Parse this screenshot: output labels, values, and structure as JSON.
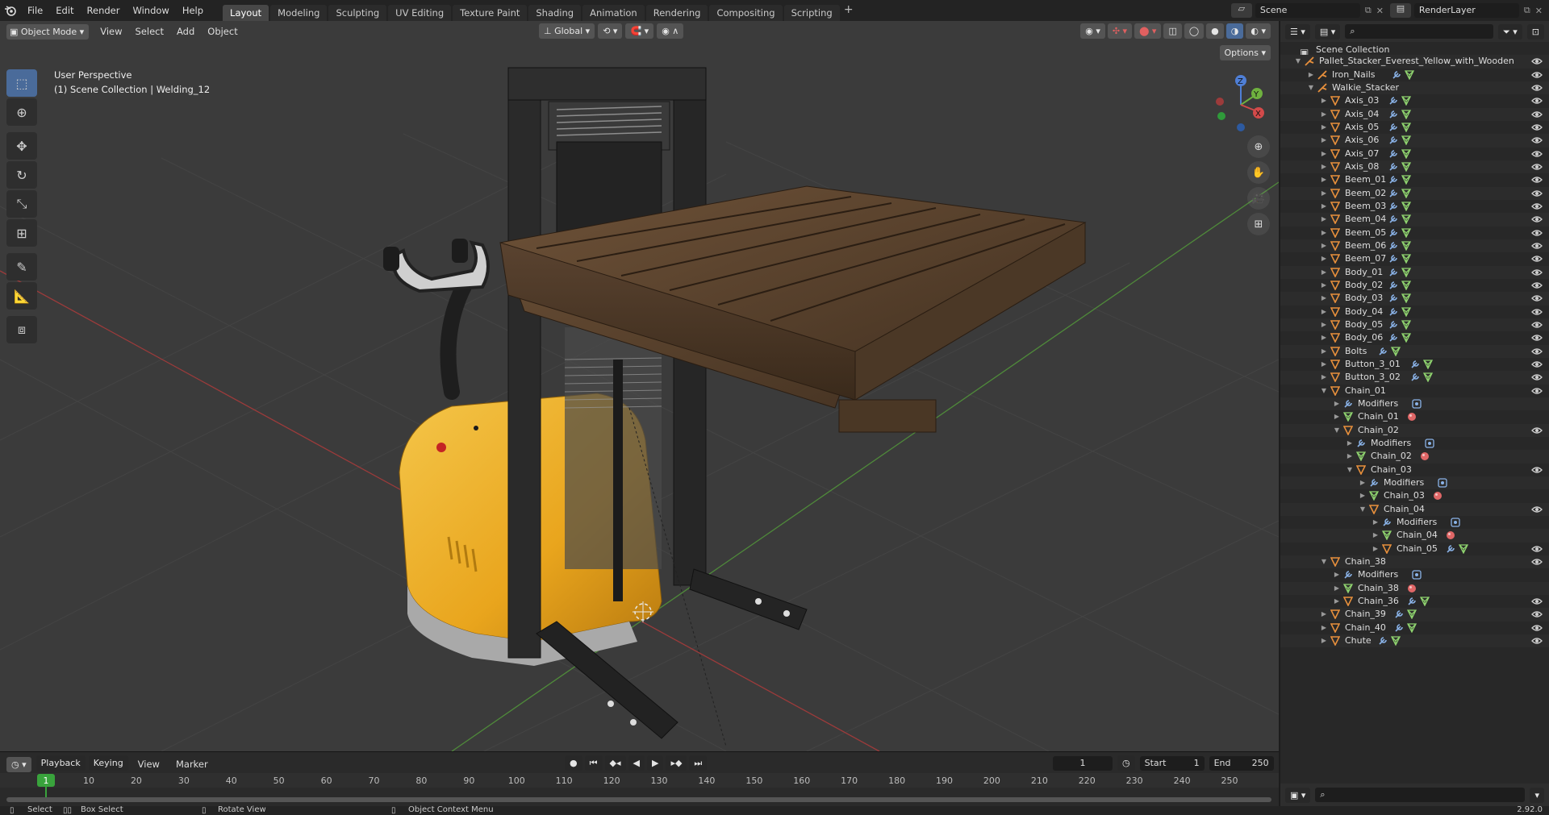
{
  "topbar": {
    "menus": [
      "File",
      "Edit",
      "Render",
      "Window",
      "Help"
    ],
    "workspaces": [
      "Layout",
      "Modeling",
      "Sculpting",
      "UV Editing",
      "Texture Paint",
      "Shading",
      "Animation",
      "Rendering",
      "Compositing",
      "Scripting"
    ],
    "active_workspace": "Layout",
    "scene": "Scene",
    "render_layer": "RenderLayer"
  },
  "viewport": {
    "mode": "Object Mode",
    "menus": [
      "View",
      "Select",
      "Add",
      "Object"
    ],
    "orientation": "Global",
    "options_label": "Options",
    "info_line1": "User Perspective",
    "info_line2": "(1) Scene Collection | Welding_12",
    "gizmo_axes": {
      "x": "X",
      "y": "Y",
      "z": "Z"
    }
  },
  "timeline": {
    "menus": [
      "Playback",
      "Keying",
      "View",
      "Marker"
    ],
    "current_frame": "1",
    "start_label": "Start",
    "start": "1",
    "end_label": "End",
    "end": "250",
    "ruler_labels": [
      "1",
      "10",
      "20",
      "30",
      "40",
      "50",
      "60",
      "70",
      "80",
      "90",
      "100",
      "110",
      "120",
      "130",
      "140",
      "150",
      "160",
      "170",
      "180",
      "190",
      "200",
      "210",
      "220",
      "230",
      "240",
      "250"
    ]
  },
  "status": {
    "select": "Select",
    "box_select": "Box Select",
    "rotate_view": "Rotate View",
    "context_menu": "Object Context Menu",
    "version": "2.92.0"
  },
  "outliner": {
    "root": "Scene Collection",
    "rows": [
      {
        "name": "Pallet_Stacker_Everest_Yellow_with_Wooden",
        "depth": 1,
        "arrow": "down",
        "icon": "armature",
        "extras": [],
        "eye": true
      },
      {
        "name": "Iron_Nails",
        "depth": 2,
        "arrow": "right",
        "icon": "armature",
        "extras": [
          "wrench",
          "mesh"
        ],
        "eye": true
      },
      {
        "name": "Walkie_Stacker",
        "depth": 2,
        "arrow": "down",
        "icon": "armature",
        "extras": [],
        "eye": true
      },
      {
        "name": "Axis_03",
        "depth": 3,
        "arrow": "right",
        "icon": "object",
        "extras": [
          "wrench",
          "mesh"
        ],
        "eye": true
      },
      {
        "name": "Axis_04",
        "depth": 3,
        "arrow": "right",
        "icon": "object",
        "extras": [
          "wrench",
          "mesh"
        ],
        "eye": true
      },
      {
        "name": "Axis_05",
        "depth": 3,
        "arrow": "right",
        "icon": "object",
        "extras": [
          "wrench",
          "mesh"
        ],
        "eye": true
      },
      {
        "name": "Axis_06",
        "depth": 3,
        "arrow": "right",
        "icon": "object",
        "extras": [
          "wrench",
          "mesh"
        ],
        "eye": true
      },
      {
        "name": "Axis_07",
        "depth": 3,
        "arrow": "right",
        "icon": "object",
        "extras": [
          "wrench",
          "mesh"
        ],
        "eye": true
      },
      {
        "name": "Axis_08",
        "depth": 3,
        "arrow": "right",
        "icon": "object",
        "extras": [
          "wrench",
          "mesh"
        ],
        "eye": true
      },
      {
        "name": "Beem_01",
        "depth": 3,
        "arrow": "right",
        "icon": "object",
        "extras": [
          "wrench",
          "mesh"
        ],
        "eye": true
      },
      {
        "name": "Beem_02",
        "depth": 3,
        "arrow": "right",
        "icon": "object",
        "extras": [
          "wrench",
          "mesh"
        ],
        "eye": true
      },
      {
        "name": "Beem_03",
        "depth": 3,
        "arrow": "right",
        "icon": "object",
        "extras": [
          "wrench",
          "mesh"
        ],
        "eye": true
      },
      {
        "name": "Beem_04",
        "depth": 3,
        "arrow": "right",
        "icon": "object",
        "extras": [
          "wrench",
          "mesh"
        ],
        "eye": true
      },
      {
        "name": "Beem_05",
        "depth": 3,
        "arrow": "right",
        "icon": "object",
        "extras": [
          "wrench",
          "mesh"
        ],
        "eye": true
      },
      {
        "name": "Beem_06",
        "depth": 3,
        "arrow": "right",
        "icon": "object",
        "extras": [
          "wrench",
          "mesh"
        ],
        "eye": true
      },
      {
        "name": "Beem_07",
        "depth": 3,
        "arrow": "right",
        "icon": "object",
        "extras": [
          "wrench",
          "mesh"
        ],
        "eye": true
      },
      {
        "name": "Body_01",
        "depth": 3,
        "arrow": "right",
        "icon": "object",
        "extras": [
          "wrench",
          "mesh"
        ],
        "eye": true
      },
      {
        "name": "Body_02",
        "depth": 3,
        "arrow": "right",
        "icon": "object",
        "extras": [
          "wrench",
          "mesh"
        ],
        "eye": true
      },
      {
        "name": "Body_03",
        "depth": 3,
        "arrow": "right",
        "icon": "object",
        "extras": [
          "wrench",
          "mesh"
        ],
        "eye": true
      },
      {
        "name": "Body_04",
        "depth": 3,
        "arrow": "right",
        "icon": "object",
        "extras": [
          "wrench",
          "mesh"
        ],
        "eye": true
      },
      {
        "name": "Body_05",
        "depth": 3,
        "arrow": "right",
        "icon": "object",
        "extras": [
          "wrench",
          "mesh"
        ],
        "eye": true
      },
      {
        "name": "Body_06",
        "depth": 3,
        "arrow": "right",
        "icon": "object",
        "extras": [
          "wrench",
          "mesh"
        ],
        "eye": true
      },
      {
        "name": "Bolts",
        "depth": 3,
        "arrow": "right",
        "icon": "object",
        "extras": [
          "wrench",
          "mesh"
        ],
        "eye": true
      },
      {
        "name": "Button_3_01",
        "depth": 3,
        "arrow": "right",
        "icon": "object",
        "extras": [
          "wrench",
          "mesh"
        ],
        "eye": true
      },
      {
        "name": "Button_3_02",
        "depth": 3,
        "arrow": "right",
        "icon": "object",
        "extras": [
          "wrench",
          "mesh"
        ],
        "eye": true
      },
      {
        "name": "Chain_01",
        "depth": 3,
        "arrow": "down",
        "icon": "object",
        "extras": [],
        "eye": true
      },
      {
        "name": "Modifiers",
        "depth": 4,
        "arrow": "right",
        "icon": "wrench",
        "extras": [
          "modifier"
        ],
        "eye": false
      },
      {
        "name": "Chain_01",
        "depth": 4,
        "arrow": "right",
        "icon": "mesh",
        "extras": [
          "material"
        ],
        "eye": false
      },
      {
        "name": "Chain_02",
        "depth": 4,
        "arrow": "down",
        "icon": "object",
        "extras": [],
        "eye": true
      },
      {
        "name": "Modifiers",
        "depth": 5,
        "arrow": "right",
        "icon": "wrench",
        "extras": [
          "modifier"
        ],
        "eye": false
      },
      {
        "name": "Chain_02",
        "depth": 5,
        "arrow": "right",
        "icon": "mesh",
        "extras": [
          "material"
        ],
        "eye": false
      },
      {
        "name": "Chain_03",
        "depth": 5,
        "arrow": "down",
        "icon": "object",
        "extras": [],
        "eye": true
      },
      {
        "name": "Modifiers",
        "depth": 6,
        "arrow": "right",
        "icon": "wrench",
        "extras": [
          "modifier"
        ],
        "eye": false
      },
      {
        "name": "Chain_03",
        "depth": 6,
        "arrow": "right",
        "icon": "mesh",
        "extras": [
          "material"
        ],
        "eye": false
      },
      {
        "name": "Chain_04",
        "depth": 6,
        "arrow": "down",
        "icon": "object",
        "extras": [],
        "eye": true
      },
      {
        "name": "Modifiers",
        "depth": 7,
        "arrow": "right",
        "icon": "wrench",
        "extras": [
          "modifier"
        ],
        "eye": false
      },
      {
        "name": "Chain_04",
        "depth": 7,
        "arrow": "right",
        "icon": "mesh",
        "extras": [
          "material"
        ],
        "eye": false
      },
      {
        "name": "Chain_05",
        "depth": 7,
        "arrow": "right",
        "icon": "object",
        "extras": [
          "wrench",
          "mesh"
        ],
        "eye": true
      },
      {
        "name": "Chain_38",
        "depth": 3,
        "arrow": "down",
        "icon": "object",
        "extras": [],
        "eye": true
      },
      {
        "name": "Modifiers",
        "depth": 4,
        "arrow": "right",
        "icon": "wrench",
        "extras": [
          "modifier"
        ],
        "eye": false
      },
      {
        "name": "Chain_38",
        "depth": 4,
        "arrow": "right",
        "icon": "mesh",
        "extras": [
          "material"
        ],
        "eye": false
      },
      {
        "name": "Chain_36",
        "depth": 4,
        "arrow": "right",
        "icon": "object",
        "extras": [
          "wrench",
          "mesh"
        ],
        "eye": true
      },
      {
        "name": "Chain_39",
        "depth": 3,
        "arrow": "right",
        "icon": "object",
        "extras": [
          "wrench",
          "mesh"
        ],
        "eye": true
      },
      {
        "name": "Chain_40",
        "depth": 3,
        "arrow": "right",
        "icon": "object",
        "extras": [
          "wrench",
          "mesh"
        ],
        "eye": true
      },
      {
        "name": "Chute",
        "depth": 3,
        "arrow": "right",
        "icon": "object",
        "extras": [
          "wrench",
          "mesh"
        ],
        "eye": true
      }
    ]
  },
  "colors": {
    "object_orange": "#e8903c",
    "mesh_green": "#8fd36f",
    "wrench_blue": "#8ab3e8",
    "material_red": "#e06767",
    "accent_blue": "#4a6b9a",
    "frame_green": "#39a33c"
  },
  "icons": {
    "menu_logo": "blender-logo-icon",
    "eye": "eye-icon",
    "search": "search-icon"
  }
}
